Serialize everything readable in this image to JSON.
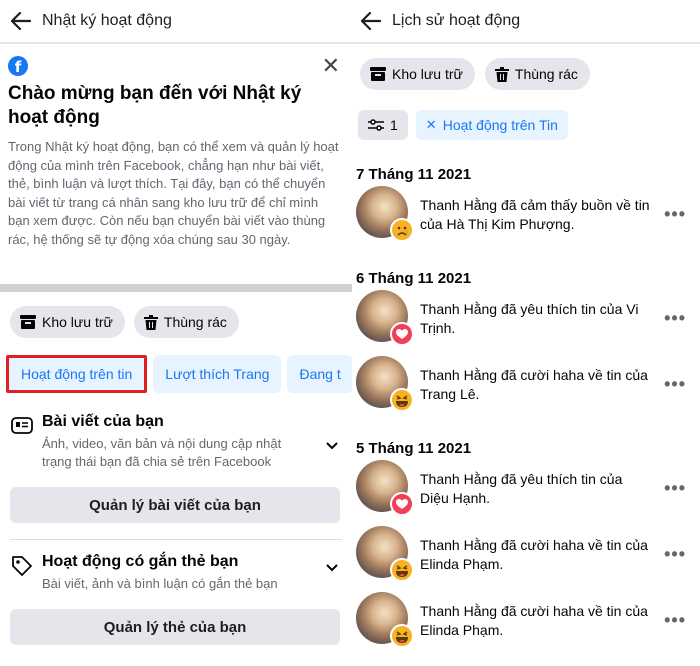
{
  "left": {
    "header_title": "Nhật ký hoạt động",
    "intro": {
      "title": "Chào mừng bạn đến với Nhật ký hoạt động",
      "body": "Trong Nhật ký hoạt động, bạn có thể xem và quản lý hoạt động của mình trên Facebook, chẳng hạn như bài viết, thẻ, bình luận và lượt thích. Tại đây, bạn có thể chuyển bài viết từ trang cá nhân sang kho lưu trữ để chỉ mình bạn xem được. Còn nếu bạn chuyển bài viết vào thùng rác, hệ thống sẽ tự động xóa chúng sau 30 ngày."
    },
    "chips": {
      "archive": "Kho lưu trữ",
      "trash": "Thùng rác"
    },
    "tabs": [
      "Hoạt động trên tin",
      "Lượt thích Trang",
      "Đang t"
    ],
    "sections": [
      {
        "title": "Bài viết của bạn",
        "subtitle": "Ảnh, video, văn bản và nội dung cập nhật trạng thái bạn đã chia sẻ trên Facebook",
        "button": "Quản lý bài viết của bạn"
      },
      {
        "title": "Hoạt động có gắn thẻ bạn",
        "subtitle": "Bài viết, ảnh và bình luận có gắn thẻ bạn",
        "button": "Quản lý thẻ của bạn"
      }
    ]
  },
  "right": {
    "header_title": "Lịch sử hoạt động",
    "chips": {
      "archive": "Kho lưu trữ",
      "trash": "Thùng rác"
    },
    "filter": {
      "count": "1",
      "tag": "Hoạt động trên Tin"
    },
    "more_label": "•••",
    "groups": [
      {
        "date": "7 Tháng 11 2021",
        "items": [
          {
            "text": "Thanh Hằng đã cảm thấy buồn về tin của Hà Thị Kim Phượng.",
            "reaction": "sad"
          }
        ]
      },
      {
        "date": "6 Tháng 11 2021",
        "items": [
          {
            "text": "Thanh Hằng đã yêu thích tin của Vi Trịnh.",
            "reaction": "love"
          },
          {
            "text": "Thanh Hằng đã cười haha về tin của Trang Lê.",
            "reaction": "haha"
          }
        ]
      },
      {
        "date": "5 Tháng 11 2021",
        "items": [
          {
            "text": "Thanh Hằng đã yêu thích tin của Diệu Hạnh.",
            "reaction": "love"
          },
          {
            "text": "Thanh Hằng đã cười haha về tin của Elinda Phạm.",
            "reaction": "haha"
          },
          {
            "text": "Thanh Hằng đã cười haha về tin của Elinda Phạm.",
            "reaction": "haha"
          }
        ]
      }
    ]
  },
  "colors": {
    "accent": "#1877f2",
    "chip_bg": "#e4e6eb",
    "tab_bg": "#e7f3ff",
    "highlight_border": "#e02020",
    "love": "#f33e58",
    "emoji": "#f7b125"
  }
}
